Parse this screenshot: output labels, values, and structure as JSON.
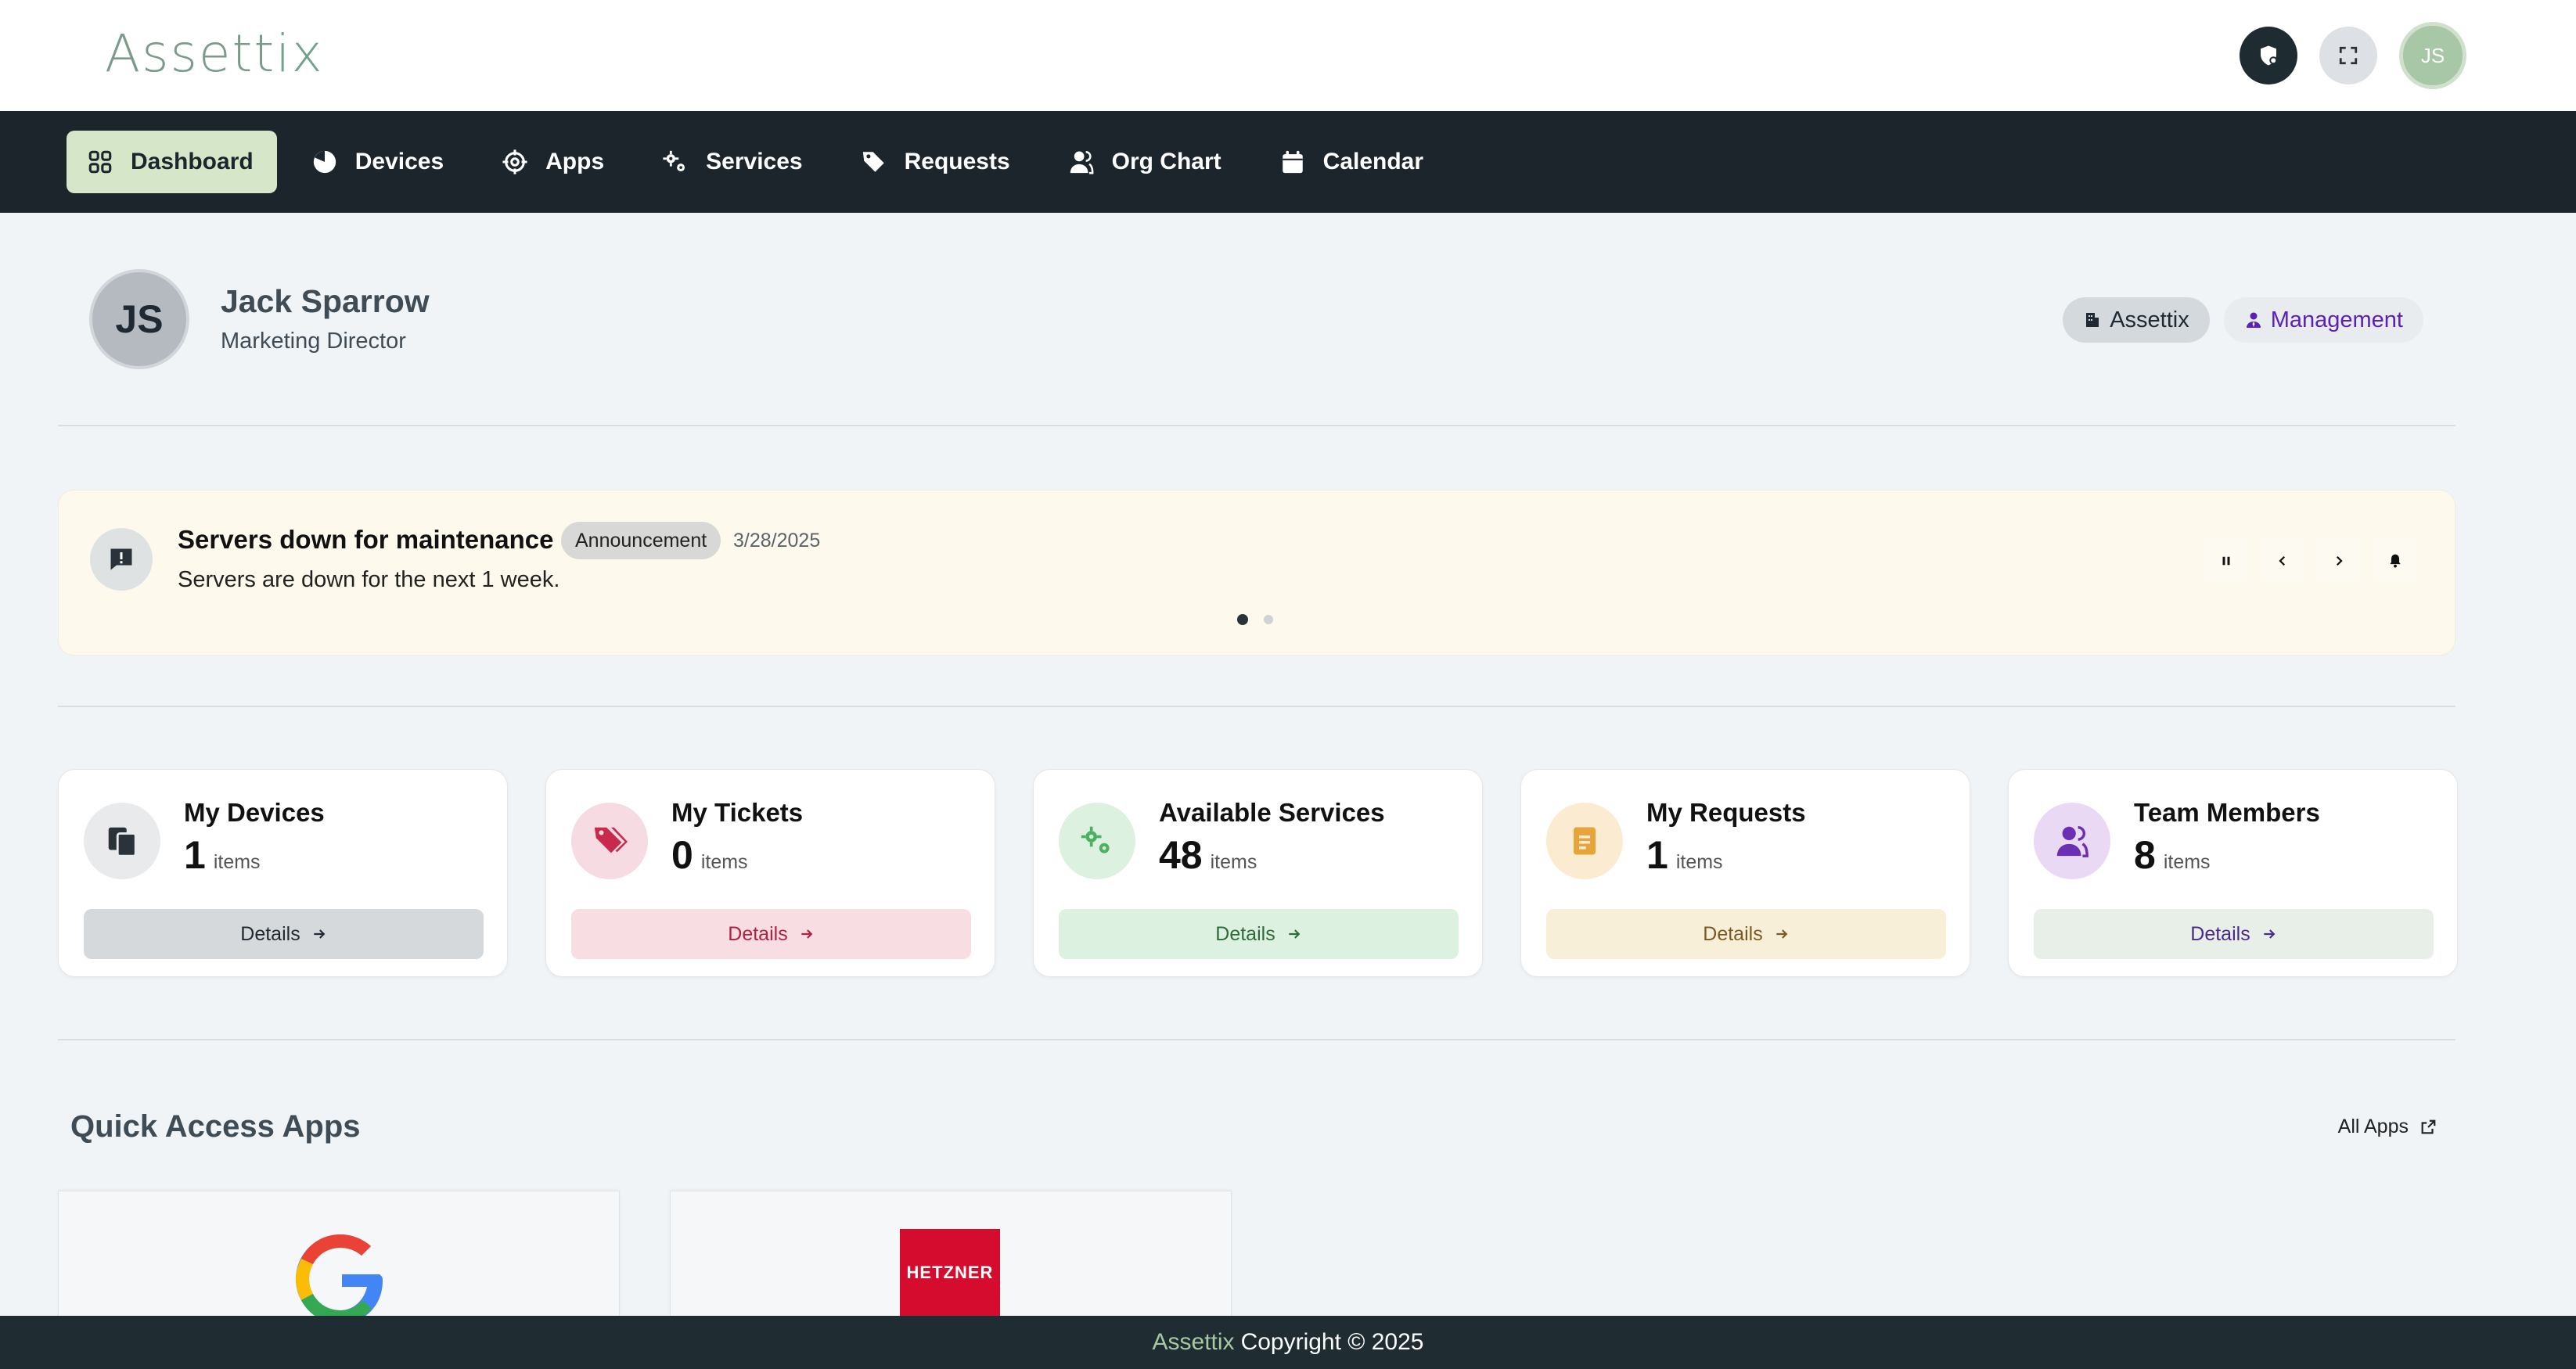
{
  "header": {
    "logo_main": "Assett",
    "logo_accent": "ix",
    "avatar_initials": "JS"
  },
  "nav": {
    "items": [
      {
        "label": "Dashboard",
        "icon": "grid-icon",
        "active": true
      },
      {
        "label": "Devices",
        "icon": "pie-icon"
      },
      {
        "label": "Apps",
        "icon": "crosshair-icon"
      },
      {
        "label": "Services",
        "icon": "gears-icon"
      },
      {
        "label": "Requests",
        "icon": "tags-icon"
      },
      {
        "label": "Org Chart",
        "icon": "users-icon"
      },
      {
        "label": "Calendar",
        "icon": "calendar-icon"
      }
    ]
  },
  "profile": {
    "initials": "JS",
    "name": "Jack Sparrow",
    "role": "Marketing Director",
    "org_tag": "Assettix",
    "dept_tag": "Management"
  },
  "announcement": {
    "title": "Servers down for maintenance",
    "badge": "Announcement",
    "date": "3/28/2025",
    "text": "Servers are down for the next 1 week."
  },
  "cards": [
    {
      "title": "My Devices",
      "count": "1",
      "unit": "items",
      "button": "Details",
      "icon": "devices-icon",
      "icon_bg": "#e8eaec",
      "icon_color": "#2a3339",
      "btn_bg": "#d6d9db",
      "btn_color": "#1f2933"
    },
    {
      "title": "My Tickets",
      "count": "0",
      "unit": "items",
      "button": "Details",
      "icon": "tags-icon",
      "icon_bg": "#f6dbe2",
      "icon_color": "#c8294d",
      "btn_bg": "#f8dde3",
      "btn_color": "#b0213f"
    },
    {
      "title": "Available Services",
      "count": "48",
      "unit": "items",
      "button": "Details",
      "icon": "gears-icon",
      "icon_bg": "#dcf1df",
      "icon_color": "#4cb061",
      "btn_bg": "#dcf1df",
      "btn_color": "#2f6b3b"
    },
    {
      "title": "My Requests",
      "count": "1",
      "unit": "items",
      "button": "Details",
      "icon": "document-icon",
      "icon_bg": "#fbebd1",
      "icon_color": "#e6a43a",
      "btn_bg": "#f8efd8",
      "btn_color": "#7a5a1f"
    },
    {
      "title": "Team Members",
      "count": "8",
      "unit": "items",
      "button": "Details",
      "icon": "users-icon",
      "icon_bg": "#ead9f4",
      "icon_color": "#6b2fb3",
      "btn_bg": "#e8efe8",
      "btn_color": "#4b2a8a"
    }
  ],
  "quick_access": {
    "title": "Quick Access Apps",
    "all_apps": "All Apps",
    "apps": [
      {
        "name": "google-logo"
      },
      {
        "name": "hetzner-logo",
        "text": "HETZNER"
      }
    ]
  },
  "footer": {
    "brand": "Assettix",
    "copyright": "Copyright © 2025"
  }
}
